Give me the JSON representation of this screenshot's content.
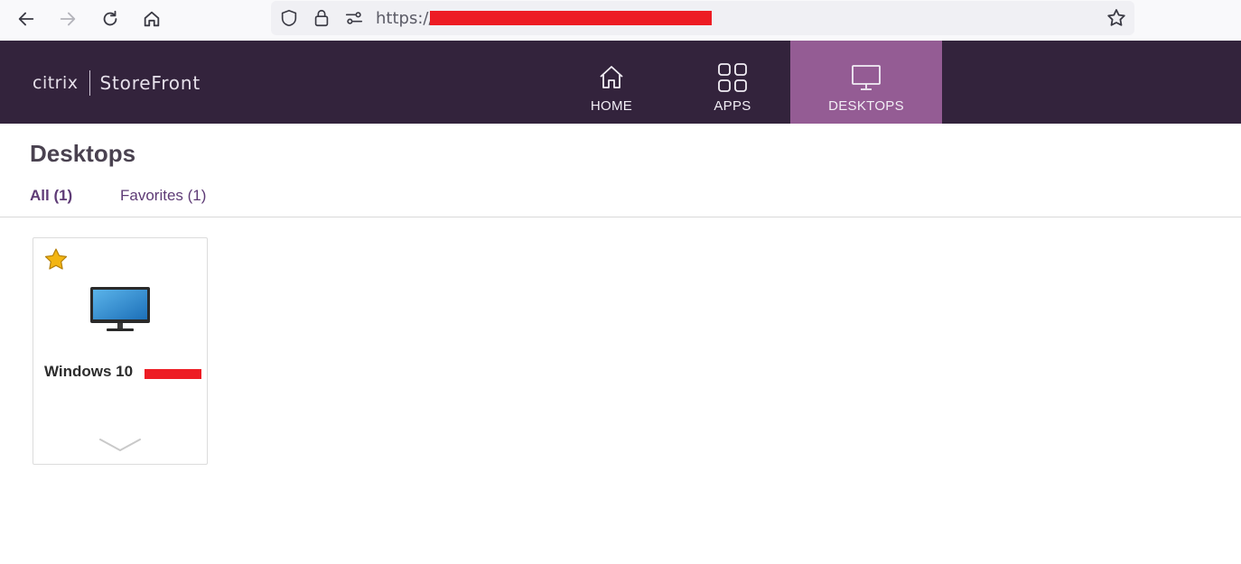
{
  "browser": {
    "url_prefix": "https://",
    "icons": [
      "back-icon",
      "forward-icon",
      "reload-icon",
      "home-icon",
      "shield-icon",
      "lock-icon",
      "permissions-icon",
      "bookmark-star-icon"
    ]
  },
  "header": {
    "logo_brand": "citrix",
    "logo_product": "StoreFront",
    "tabs": [
      {
        "label": "HOME",
        "icon": "home-icon",
        "active": false
      },
      {
        "label": "APPS",
        "icon": "apps-grid-icon",
        "active": false
      },
      {
        "label": "DESKTOPS",
        "icon": "monitor-icon",
        "active": true
      }
    ],
    "colors": {
      "background": "#33233c",
      "active_tab": "#945c94"
    }
  },
  "main": {
    "title": "Desktops",
    "filters": [
      {
        "label": "All (1)",
        "selected": true
      },
      {
        "label": "Favorites (1)",
        "selected": false
      }
    ],
    "desktops": [
      {
        "name": "Windows 10",
        "favorite": true,
        "icon": "desktop-monitor-icon"
      }
    ]
  }
}
